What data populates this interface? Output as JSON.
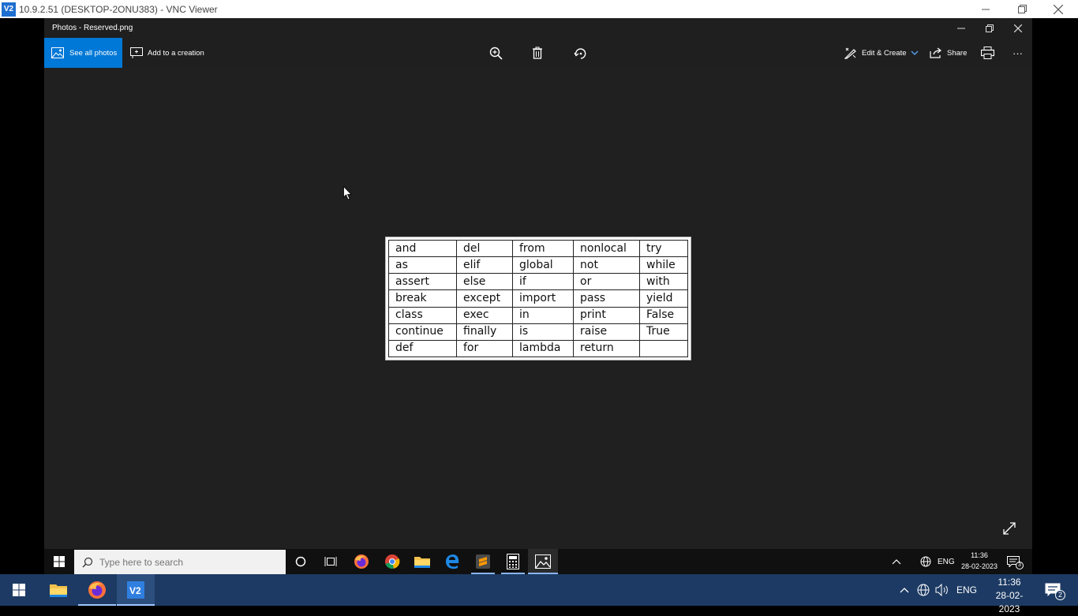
{
  "vnc": {
    "logo": "V2",
    "title": "10.9.2.51 (DESKTOP-2ONU383) - VNC Viewer",
    "icons": {
      "minimize": "minimize-icon",
      "restore": "restore-icon",
      "close": "close-icon"
    }
  },
  "photos": {
    "title": "Photos - Reserved.png",
    "toolbar": {
      "see_all": "See all photos",
      "add_creation": "Add to a creation",
      "edit_create": "Edit & Create",
      "share": "Share",
      "more": "···"
    }
  },
  "keywords_table": {
    "rows": [
      [
        "and",
        "del",
        "from",
        "nonlocal",
        "try"
      ],
      [
        "as",
        "elif",
        "global",
        "not",
        "while"
      ],
      [
        "assert",
        "else",
        "if",
        "or",
        "with"
      ],
      [
        "break",
        "except",
        "import",
        "pass",
        "yield"
      ],
      [
        "class",
        "exec",
        "in",
        "print",
        "False"
      ],
      [
        "continue",
        "finally",
        "is",
        "raise",
        "True"
      ],
      [
        "def",
        "for",
        "lambda",
        "return",
        ""
      ]
    ]
  },
  "remote_taskbar": {
    "search_placeholder": "Type here to search",
    "lang": "ENG",
    "time": "11:36",
    "date": "28-02-2023",
    "notifications": "3"
  },
  "local_taskbar": {
    "lang": "ENG",
    "time": "11:36",
    "date": "28-02-2023",
    "notifications": "2"
  },
  "colors": {
    "accent": "#0078d7",
    "local_taskbar": "#1c3a63",
    "photos_bg": "#202020"
  }
}
